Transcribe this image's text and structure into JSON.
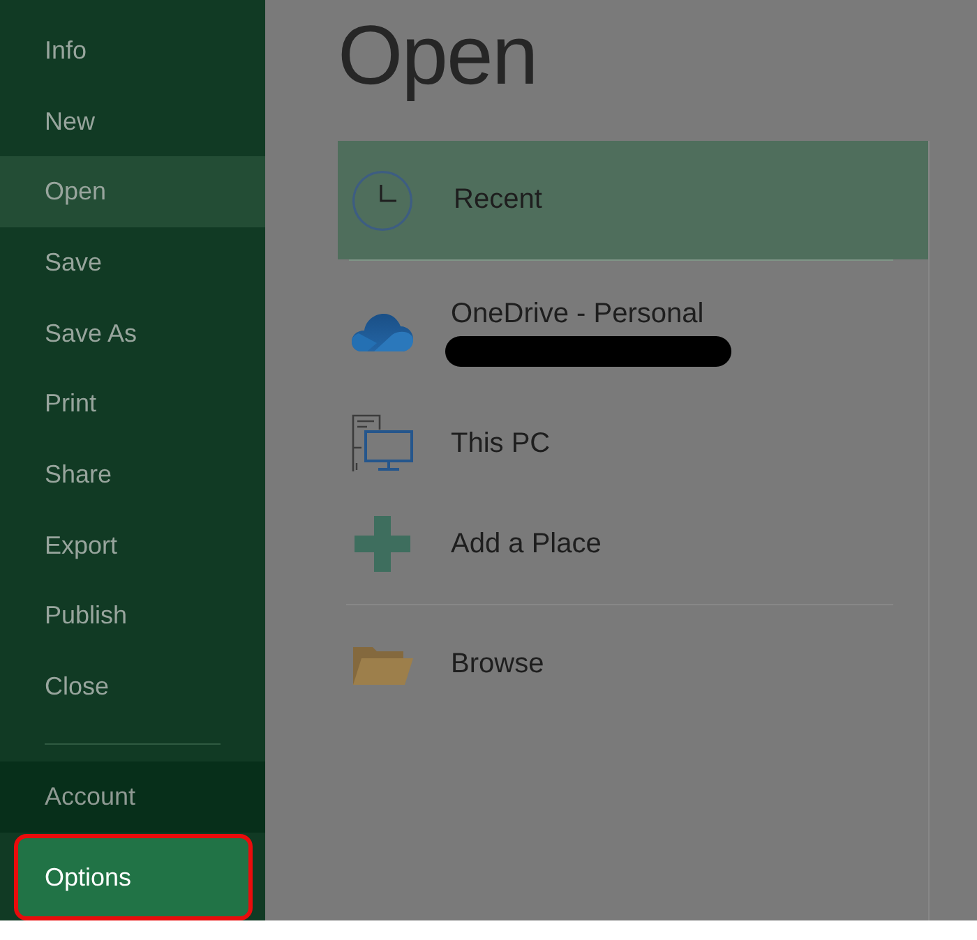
{
  "sidebar": {
    "items": [
      {
        "label": "Info",
        "selected": false
      },
      {
        "label": "New",
        "selected": false
      },
      {
        "label": "Open",
        "selected": true
      },
      {
        "label": "Save",
        "selected": false
      },
      {
        "label": "Save As",
        "selected": false
      },
      {
        "label": "Print",
        "selected": false
      },
      {
        "label": "Share",
        "selected": false
      },
      {
        "label": "Export",
        "selected": false
      },
      {
        "label": "Publish",
        "selected": false
      },
      {
        "label": "Close",
        "selected": false
      }
    ],
    "bottom_items": [
      {
        "label": "Account",
        "hovered": false,
        "outlined": false
      },
      {
        "label": "Options",
        "hovered": true,
        "outlined": true
      }
    ]
  },
  "main": {
    "title": "Open",
    "location_groups": [
      {
        "items": [
          {
            "kind": "recent",
            "label": "Recent",
            "selected": true,
            "redacted_subtitle": false
          }
        ]
      },
      {
        "items": [
          {
            "kind": "cloud",
            "label": "OneDrive - Personal",
            "selected": false,
            "redacted_subtitle": true
          },
          {
            "kind": "computer",
            "label": "This PC",
            "selected": false,
            "redacted_subtitle": false
          },
          {
            "kind": "add",
            "label": "Add a Place",
            "selected": false,
            "redacted_subtitle": false
          }
        ]
      },
      {
        "items": [
          {
            "kind": "folder",
            "label": "Browse",
            "selected": false,
            "redacted_subtitle": false
          }
        ]
      }
    ]
  }
}
